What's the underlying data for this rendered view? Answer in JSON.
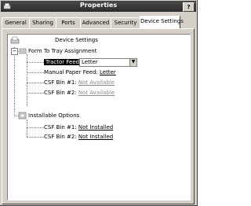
{
  "window": {
    "title": "Properties",
    "help_label": "?"
  },
  "tabs": [
    {
      "label": "General"
    },
    {
      "label": "Sharing"
    },
    {
      "label": "Ports"
    },
    {
      "label": "Advanced"
    },
    {
      "label": "Security"
    },
    {
      "label": "Device Settings"
    }
  ],
  "tree": {
    "root_label": "Device Settings",
    "form_to_tray": {
      "label": "Form To Tray Assignment",
      "tractor_feed_label": "Tractor Feed:",
      "tractor_feed_value": "Letter",
      "manual_paper_feed_label": "Manual Paper Feed:",
      "manual_paper_feed_value": "Letter",
      "csf1_label": "CSF Bin #1:",
      "csf1_value": "Not Available",
      "csf2_label": "CSF Bin #2:",
      "csf2_value": "Not Available"
    },
    "installable_options": {
      "label": "Installable Options",
      "csf1_label": "CSF Bin #1:",
      "csf1_value": "Not Installed",
      "csf2_label": "CSF Bin #2:",
      "csf2_value": "Not Installed"
    }
  },
  "expander_symbol": "−",
  "dropdown_arrow": "▼"
}
